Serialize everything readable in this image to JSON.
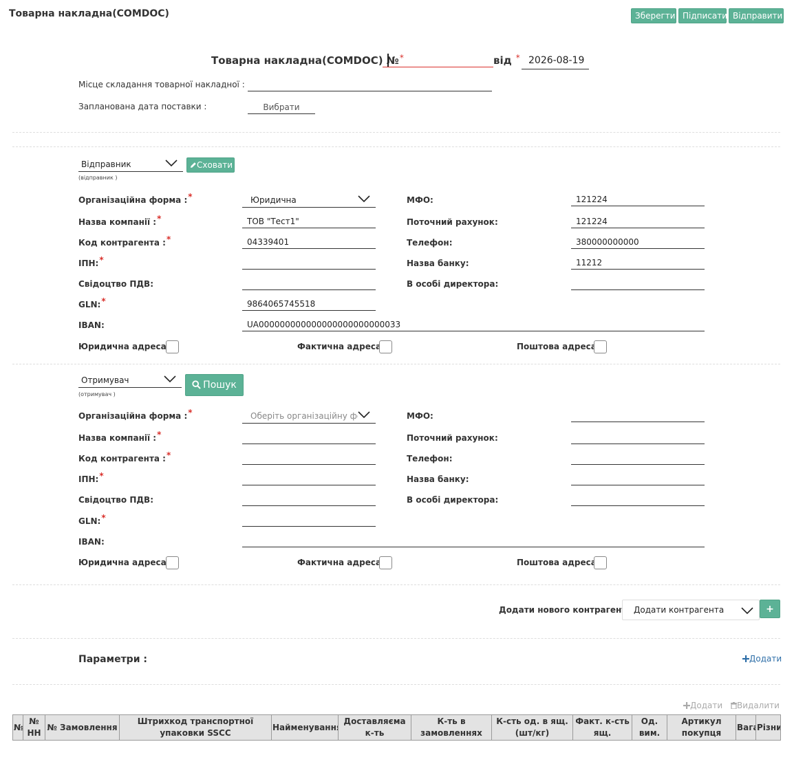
{
  "header": {
    "title": "Товарна накладна(COMDOC)",
    "save_label": "Зберегти",
    "sign_label": "Підписати",
    "send_label": "Відправити"
  },
  "document": {
    "title": "Товарна накладна(COMDOC) №",
    "number_value": "",
    "from_label": "від",
    "date_value": "2026-08-19",
    "place_label": "Місце складання товарної накладної :",
    "place_value": "",
    "planned_date_label": "Запланована дата поставки :",
    "planned_date_button": "Вибрати"
  },
  "sender": {
    "role_value": "Відправник",
    "role_caption": "(відправник )",
    "hide_button": "Сховати",
    "fields": {
      "org_form_label": "Організаційна форма :",
      "org_form_value": "Юридична",
      "company_label": "Назва компанії :",
      "company_value": "ТОВ \"Тест1\"",
      "code_label": "Код контрагента :",
      "code_value": "04339401",
      "ipn_label": "ІПН:",
      "ipn_value": "",
      "vat_label": "Свідоцтво ПДВ:",
      "vat_value": "",
      "gln_label": "GLN:",
      "gln_value": "9864065745518",
      "iban_label": "IBAN:",
      "iban_value": "UA000000000000000000000000033",
      "mfo_label": "МФО:",
      "mfo_value": "121224",
      "account_label": "Поточний рахунок:",
      "account_value": "121224",
      "phone_label": "Телефон:",
      "phone_value": "380000000000",
      "bank_label": "Назва банку:",
      "bank_value": "11212",
      "director_label": "В особі директора:",
      "director_value": ""
    },
    "legal_address_label": "Юридична адреса :",
    "actual_address_label": "Фактична адреса:",
    "postal_address_label": "Поштова адреса:"
  },
  "receiver": {
    "role_value": "Отримувач",
    "role_caption": "(отримувач )",
    "search_button": "Пошук",
    "fields": {
      "org_form_label": "Організаційна форма :",
      "org_form_placeholder": "Оберіть організаційну фо",
      "company_label": "Назва компанії :",
      "code_label": "Код контрагента :",
      "ipn_label": "ІПН:",
      "vat_label": "Свідоцтво ПДВ:",
      "gln_label": "GLN:",
      "iban_label": "IBAN:",
      "mfo_label": "МФО:",
      "account_label": "Поточний рахунок:",
      "phone_label": "Телефон:",
      "bank_label": "Назва банку:",
      "director_label": "В особі директора:"
    },
    "legal_address_label": "Юридична адреса :",
    "actual_address_label": "Фактична адреса:",
    "postal_address_label": "Поштова адреса:"
  },
  "new_contractor": {
    "label": "Додати нового контрагента:",
    "select_value": "Додати контрагента",
    "add_button": "+"
  },
  "params": {
    "title": "Параметри :",
    "add_link": "Додати"
  },
  "table_actions": {
    "add": "Додати",
    "delete": "Видалити"
  },
  "table": {
    "columns": [
      "№",
      "№ НН",
      "№ Замовлення",
      "Штрихкод транспортної упаковки SSCC",
      "Найменування",
      "Доставляєма к-ть",
      "К-ть в замовленнях",
      "К-сть од. в ящ. (шт/кг)",
      "Факт. к-сть ящ.",
      "Од. вим.",
      "Артикул покупця",
      "Вага",
      "Різниця"
    ]
  },
  "colors": {
    "accent_green": "#5cb296",
    "required_red": "#d9302b",
    "link_blue": "#2f6fa8"
  },
  "icons": {
    "dropdown": "chevron-down-icon",
    "hide": "pencil-icon",
    "search": "search-icon",
    "add": "plus-icon",
    "delete": "trash-icon"
  }
}
